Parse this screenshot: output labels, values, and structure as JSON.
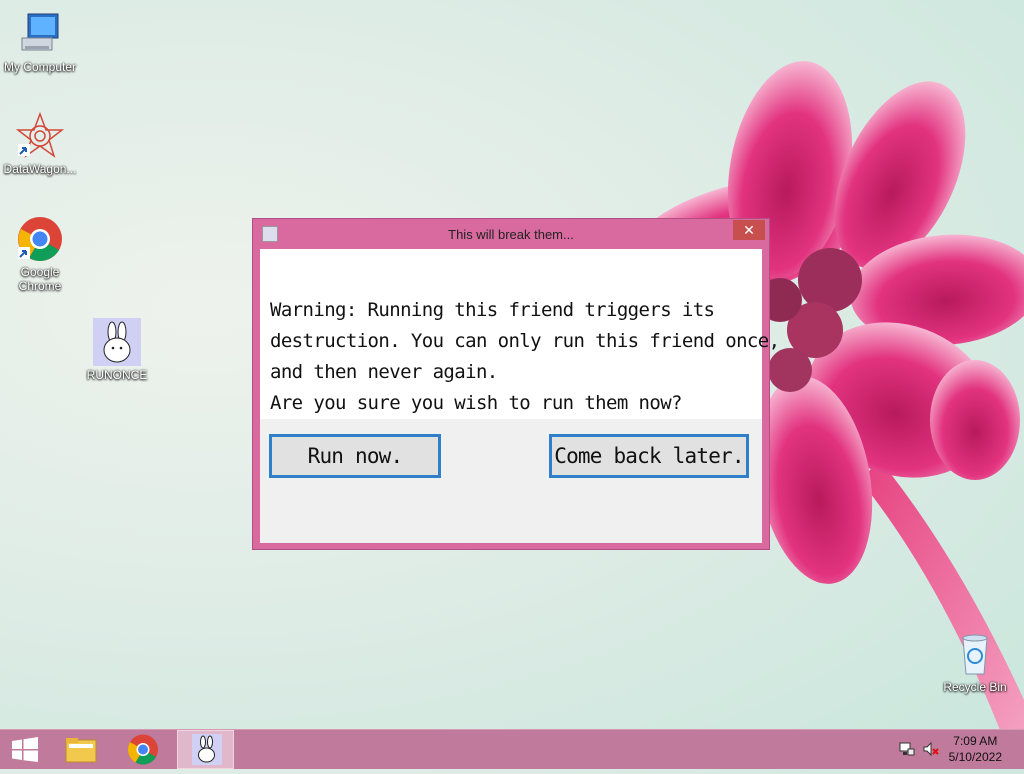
{
  "desktop": {
    "icons": [
      {
        "label": "My Computer",
        "icon": "computer-icon"
      },
      {
        "label": "DataWagon...",
        "icon": "datawagon-icon"
      },
      {
        "label": "Google Chrome",
        "icon": "chrome-icon"
      },
      {
        "label": "RUNONCE",
        "icon": "bunny-icon"
      },
      {
        "label": "Recycle Bin",
        "icon": "recycle-bin-icon"
      }
    ]
  },
  "dialog": {
    "title": "This will break them...",
    "close_glyph": "✕",
    "message": [
      "Warning: Running this friend triggers its",
      "destruction. You can only run this friend once,",
      "and then never again.",
      "Are you sure you wish to run them now?"
    ],
    "run_label": "Run now.",
    "later_label": "Come back later."
  },
  "taskbar": {
    "items": [
      {
        "icon": "windows-start-icon"
      },
      {
        "icon": "file-explorer-icon"
      },
      {
        "icon": "chrome-icon"
      },
      {
        "icon": "bunny-icon",
        "active": true
      }
    ],
    "tray": [
      "network-icon",
      "volume-muted-icon"
    ],
    "time": "7:09 AM",
    "date": "5/10/2022"
  },
  "colors": {
    "accent": "#d96a9f",
    "button_border": "#2f7fc9",
    "taskbar": "#c07a9b"
  }
}
